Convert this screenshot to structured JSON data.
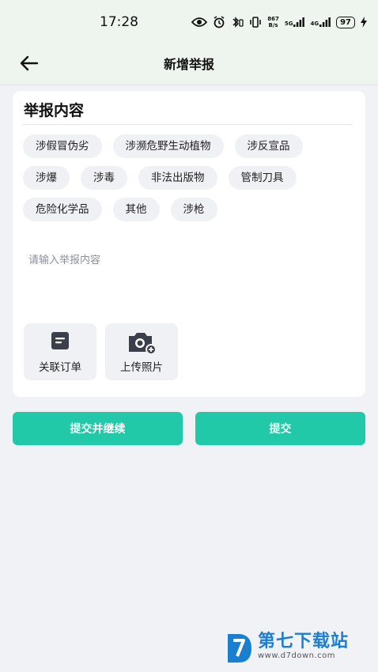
{
  "status_bar": {
    "time": "17:28",
    "net_speed_value": "867",
    "net_speed_unit": "B/s",
    "sig1_label": "5G",
    "sig2_label": "4G",
    "battery": "97"
  },
  "header": {
    "title": "新增举报"
  },
  "report": {
    "section_title": "举报内容",
    "tags": [
      "涉假冒伪劣",
      "涉濒危野生动植物",
      "涉反宣品",
      "涉爆",
      "涉毒",
      "非法出版物",
      "管制刀具",
      "危险化学品",
      "其他",
      "涉枪"
    ],
    "input_placeholder": "请输入举报内容",
    "link_order_label": "关联订单",
    "upload_photo_label": "上传照片"
  },
  "actions": {
    "submit_continue": "提交并继续",
    "submit": "提交"
  },
  "watermark": {
    "brand": "第七下载站",
    "url": "www.d7down.com"
  },
  "colors": {
    "accent": "#22c9a8",
    "header_bg": "#eef5ef",
    "page_bg": "#f1f2f6",
    "tag_bg": "#f0f1f5"
  }
}
